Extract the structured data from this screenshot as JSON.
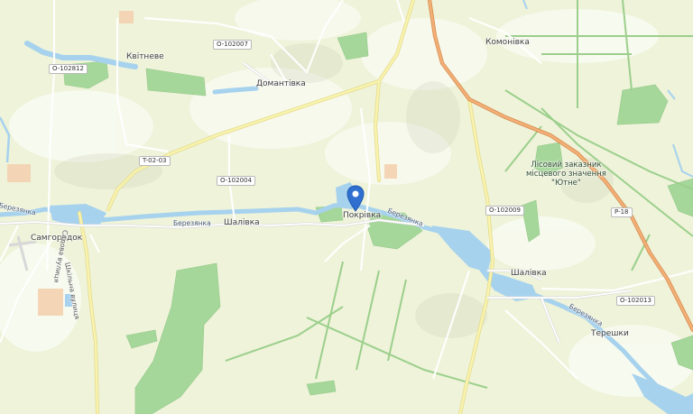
{
  "places": {
    "kvitneve": "Квітневе",
    "domantivka": "Домантівка",
    "komonivka": "Комонівка",
    "shalivka_1": "Шалівка",
    "pokrivka": "Покрівка",
    "shalivka_2": "Шалівка",
    "samhorodok": "Самгородок",
    "tereshky": "Терешки"
  },
  "reserve_label": {
    "line1": "Лісовий заказник",
    "line2": "місцевого значення",
    "line3": "\"Ютне\""
  },
  "road_refs": {
    "o102812": "O-102812",
    "o102007": "O-102007",
    "t0203": "T-02-03",
    "o102004": "O-102004",
    "o102009": "O-102009",
    "p18": "P-18",
    "o102013": "O-102013"
  },
  "water_labels": {
    "berezyanka_w": "Березянка",
    "berezyanka_mid": "Березянка",
    "berezyanka_e": "Березянка",
    "berezyanka_se": "Березянка"
  },
  "street_labels": {
    "sadova": "Садова вулиця",
    "shkilna": "Шкільна вулиця"
  },
  "marker": {
    "icon": "map-pin-icon",
    "color": "#2f6fd0"
  },
  "colors": {
    "land": "#eef3d9",
    "forest": "#a6d79a",
    "water": "#a6d2ee",
    "major_road": "#e9a46a",
    "minor_road": "#f5f0a4",
    "track": "#ffffff"
  }
}
